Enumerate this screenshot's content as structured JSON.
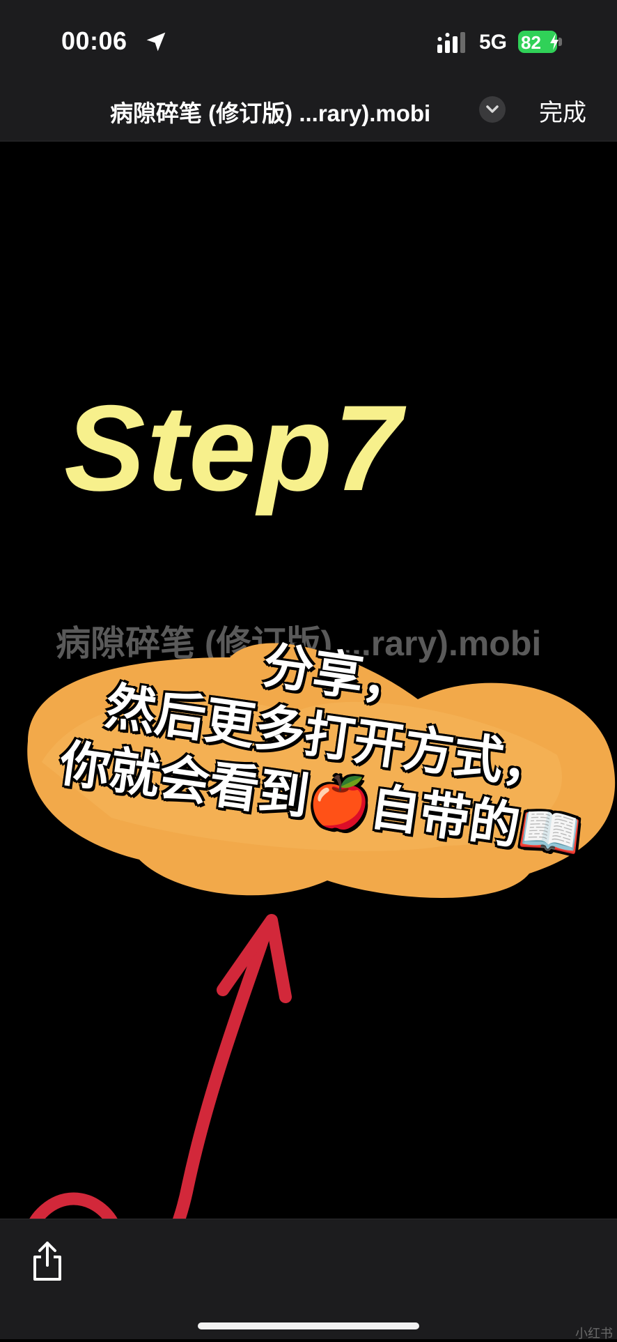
{
  "status_bar": {
    "time": "00:06",
    "network": "5G",
    "battery": "82"
  },
  "nav": {
    "title": "病隙碎笔 (修订版) ...rary).mobi",
    "done_label": "完成"
  },
  "content": {
    "step_title": "Step7",
    "file_name": "病隙碎笔 (修订版) ...rary).mobi",
    "annotation_lines": [
      "分享，",
      "然后更多打开方式，",
      "你就会看到🍎自带的📖"
    ]
  },
  "colors": {
    "step_title": "#f7f08c",
    "scribble": "#f2a94a",
    "arrow": "#d2283a",
    "battery": "#30d158"
  },
  "icons": {
    "location": "location-arrow-icon",
    "share": "share-icon",
    "chevron": "chevron-down-icon"
  },
  "watermark": "小红书"
}
